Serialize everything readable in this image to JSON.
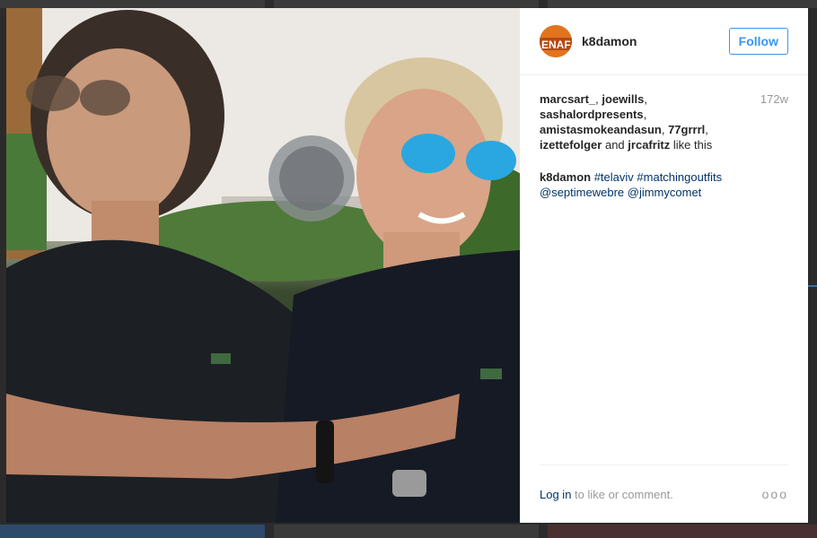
{
  "post": {
    "username": "k8damon",
    "follow_label": "Follow",
    "age": "172w",
    "likes": {
      "names": [
        "marcsart_",
        "joewills",
        "sashalordpresents",
        "amistasmokeandasun",
        "77grrrl",
        "izettefolger"
      ],
      "connector": "and",
      "last_name": "jrcafritz",
      "suffix": "like this"
    },
    "caption": {
      "author": "k8damon",
      "hashtags": [
        "#telaviv",
        "#matchingoutfits"
      ],
      "mentions": [
        "@septimewebre",
        "@jimmycomet"
      ]
    }
  },
  "footer": {
    "login_label": "Log in",
    "login_suffix": "to like or comment.",
    "more_label": "ooo"
  },
  "colors": {
    "accent": "#3897f0",
    "link": "#003569",
    "muted": "#999999"
  }
}
